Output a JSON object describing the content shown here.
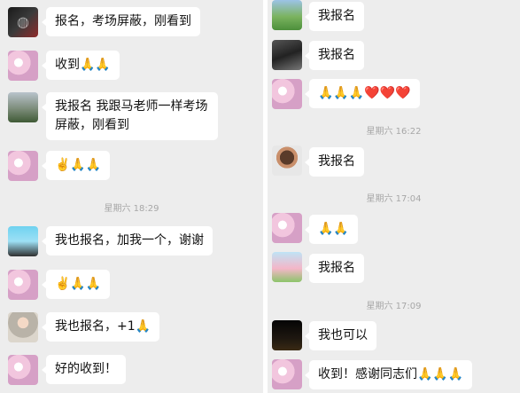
{
  "left": {
    "messages": [
      {
        "text": "报名，考场屏蔽，刚看到",
        "avatar": "red-portrait-avatar"
      },
      {
        "text": "收到🙏🙏",
        "avatar": "pink-flowers-avatar"
      },
      {
        "text": "我报名 我跟马老师一样考场屏蔽，刚看到",
        "avatar": "tree-landscape-avatar"
      },
      {
        "text": "✌️🙏🙏",
        "avatar": "pink-flowers-avatar"
      },
      {
        "text": "我也报名，加我一个，谢谢",
        "avatar": "sky-portrait-avatar"
      },
      {
        "text": "✌️🙏🙏",
        "avatar": "pink-flowers-avatar"
      },
      {
        "text": "我也报名，+1🙏",
        "avatar": "girl-portrait-avatar"
      },
      {
        "text": "好的收到！",
        "avatar": "pink-flowers-avatar"
      }
    ],
    "timestamp": "星期六 18:29"
  },
  "right": {
    "messages": [
      {
        "text": "我报名",
        "avatar": "field-photo-avatar"
      },
      {
        "text": "我报名",
        "avatar": "bicycle-photo-avatar"
      },
      {
        "text": "🙏🙏🙏❤️❤️❤️",
        "avatar": "pink-flowers-avatar"
      },
      {
        "text": "我报名",
        "avatar": "cartoon-girl-avatar"
      },
      {
        "text": "🙏🙏",
        "avatar": "pink-flowers-avatar"
      },
      {
        "text": "我报名",
        "avatar": "cartoon-pigs-avatar"
      },
      {
        "text": "我也可以",
        "avatar": "night-photo-avatar"
      },
      {
        "text": "收到！感谢同志们🙏🙏🙏",
        "avatar": "pink-flowers-avatar"
      }
    ],
    "timestamps": [
      "星期六 16:22",
      "星期六 17:04",
      "星期六 17:09"
    ]
  },
  "colors": {
    "chat_background": "#ededed",
    "bubble_background": "#ffffff",
    "timestamp_text": "#a7a7a7"
  }
}
